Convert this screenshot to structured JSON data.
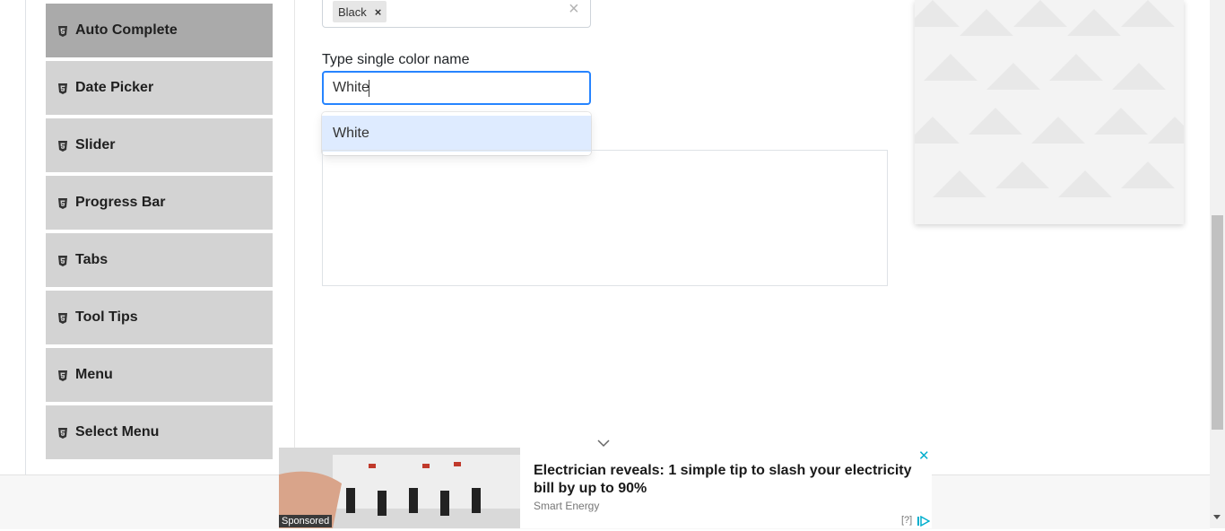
{
  "sidebar": {
    "items": [
      {
        "label": "Auto Complete",
        "active": true
      },
      {
        "label": "Date Picker"
      },
      {
        "label": "Slider"
      },
      {
        "label": "Progress Bar"
      },
      {
        "label": "Tabs"
      },
      {
        "label": "Tool Tips"
      },
      {
        "label": "Menu"
      },
      {
        "label": "Select Menu"
      }
    ]
  },
  "multi": {
    "tags": [
      "Black"
    ],
    "tag_remove": "×",
    "clear": "×"
  },
  "single": {
    "label": "Type single color name",
    "value": "White",
    "options": [
      "White"
    ]
  },
  "ad": {
    "headline": "Electrician reveals: 1 simple tip to slash your electricity bill by up to 90%",
    "brand": "Smart Energy",
    "sponsored": "Sponsored",
    "close": "✕",
    "help": "[?]"
  },
  "colors": {
    "accent": "#2684ff",
    "option_highlight": "#deebff",
    "sidebar_bg": "#d3d3d3",
    "sidebar_active": "#aaaaaa"
  }
}
